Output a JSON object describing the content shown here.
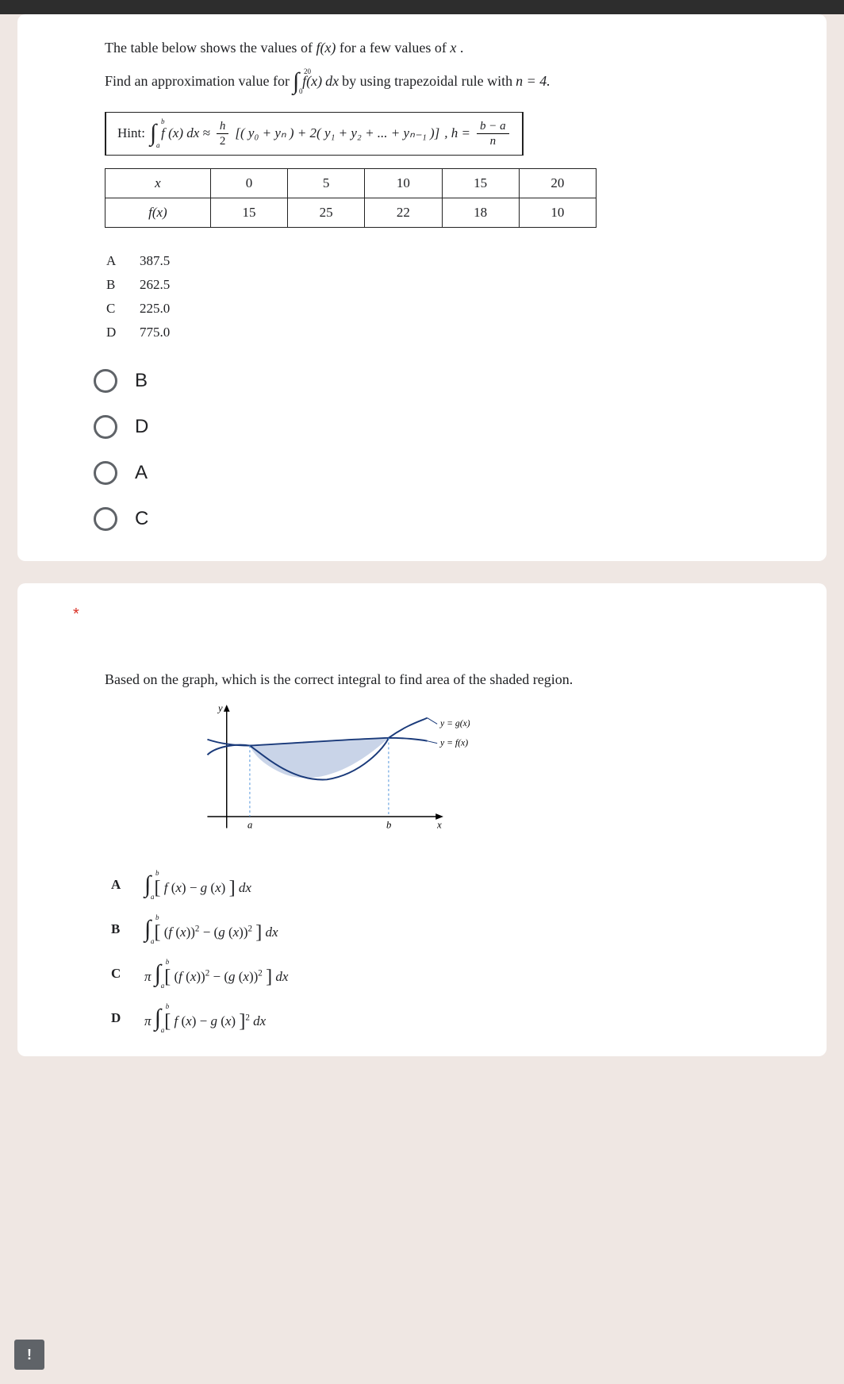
{
  "q1": {
    "prompt_pre": "The table below shows the values of ",
    "prompt_fx": "f(x)",
    "prompt_mid": " for a few values of ",
    "prompt_x": "x",
    "prompt_end": " .",
    "line2_pre": "Find an approximation value for ",
    "line2_int_upper": "20",
    "line2_int_lower": "0",
    "line2_fx": "f(x)",
    "line2_dx": " dx",
    "line2_post": " by using trapezoidal rule with ",
    "line2_n": "n = 4.",
    "hint_label": "Hint:",
    "hint_int_upper": "b",
    "hint_int_lower": "a",
    "hint_formula_left": "f (x) dx ≈",
    "hint_frac_h_num": "h",
    "hint_frac_h_den": "2",
    "hint_bracket": "[( y₀ + yₙ ) + 2( y₁ + y₂ + ... + yₙ₋₁ )]",
    "hint_comma_h": ", h =",
    "hint_frac_ba_num": "b − a",
    "hint_frac_ba_den": "n",
    "table": {
      "row1": [
        "x",
        "0",
        "5",
        "10",
        "15",
        "20"
      ],
      "row2": [
        "f(x)",
        "15",
        "25",
        "22",
        "18",
        "10"
      ]
    },
    "choices": [
      {
        "letter": "A",
        "value": "387.5"
      },
      {
        "letter": "B",
        "value": "262.5"
      },
      {
        "letter": "C",
        "value": "225.0"
      },
      {
        "letter": "D",
        "value": "775.0"
      }
    ],
    "radio_options": [
      "B",
      "D",
      "A",
      "C"
    ]
  },
  "q2": {
    "required": "*",
    "prompt": "Based on the graph, which is the correct integral to find area of the shaded region.",
    "graph": {
      "ylabel": "y",
      "xlabel": "x",
      "a": "a",
      "b": "b",
      "g_label": "y = g(x)",
      "f_label": "y = f(x)"
    },
    "choices": [
      {
        "letter": "A",
        "pre": "",
        "int_lower": "a",
        "int_upper": "b",
        "body": "[ f (x) − g (x) ] dx",
        "squared_outer": false
      },
      {
        "letter": "B",
        "pre": "",
        "int_lower": "a",
        "int_upper": "b",
        "body": "[ (f (x))² − (g (x))² ] dx",
        "squared_outer": false
      },
      {
        "letter": "C",
        "pre": "π",
        "int_lower": "a",
        "int_upper": "b",
        "body": "[ (f (x))² − (g (x))² ] dx",
        "squared_outer": false
      },
      {
        "letter": "D",
        "pre": "π",
        "int_lower": "a",
        "int_upper": "b",
        "body": "[ f (x) − g (x) ]² dx",
        "squared_outer": true
      }
    ]
  },
  "feedback_icon": "!"
}
